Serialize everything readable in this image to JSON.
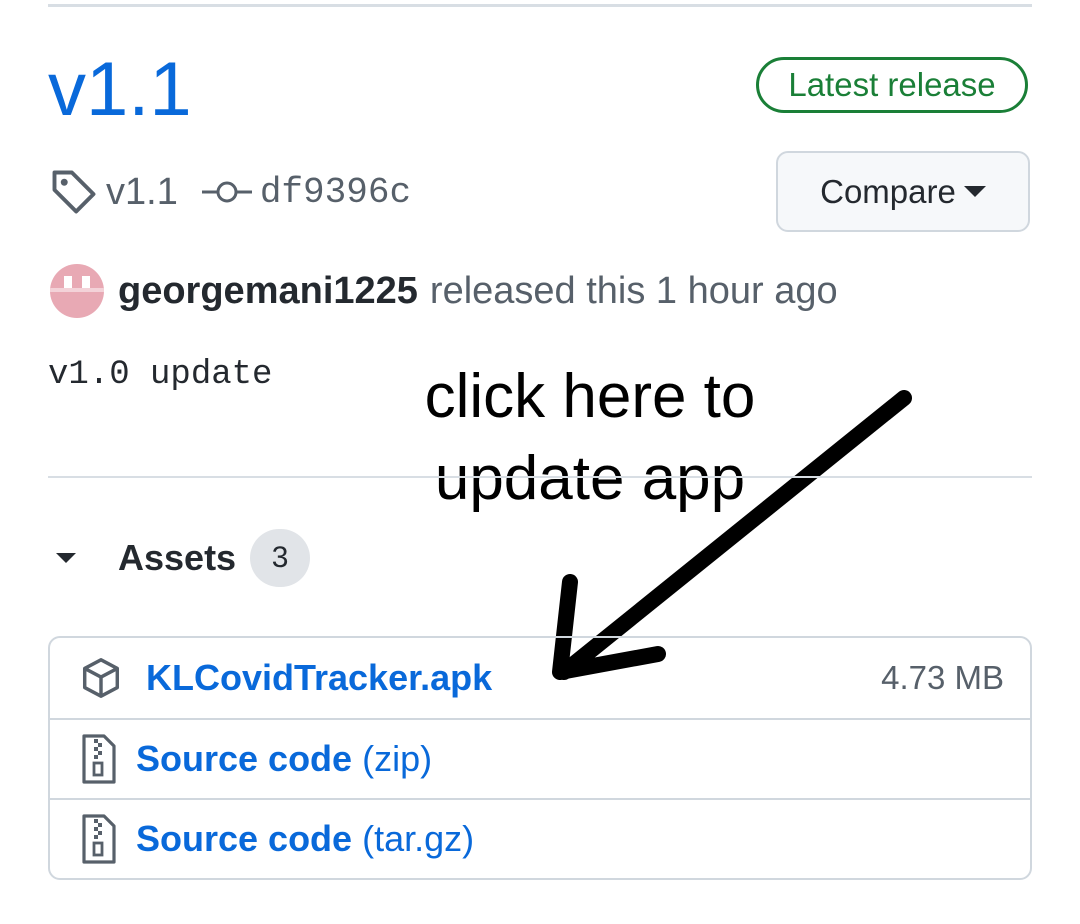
{
  "release": {
    "title": "v1.1",
    "badge": "Latest release",
    "tag": "v1.1",
    "commit": "df9396c",
    "compare_label": "Compare",
    "author": "georgemani1225",
    "released_text": "released this 1 hour ago",
    "notes": "v1.0 update"
  },
  "annotation": {
    "line1": "click here to",
    "line2": "update app"
  },
  "assets": {
    "label": "Assets",
    "count": "3",
    "items": [
      {
        "name": "KLCovidTracker.apk",
        "suffix": "",
        "size": "4.73 MB",
        "icon": "package-icon"
      },
      {
        "name": "Source code",
        "suffix": "(zip)",
        "size": "",
        "icon": "file-zip-icon"
      },
      {
        "name": "Source code",
        "suffix": "(tar.gz)",
        "size": "",
        "icon": "file-zip-icon"
      }
    ]
  },
  "colors": {
    "link": "#0969da",
    "badge_green": "#1a7f37",
    "muted": "#57606a",
    "border": "#d0d7de"
  }
}
